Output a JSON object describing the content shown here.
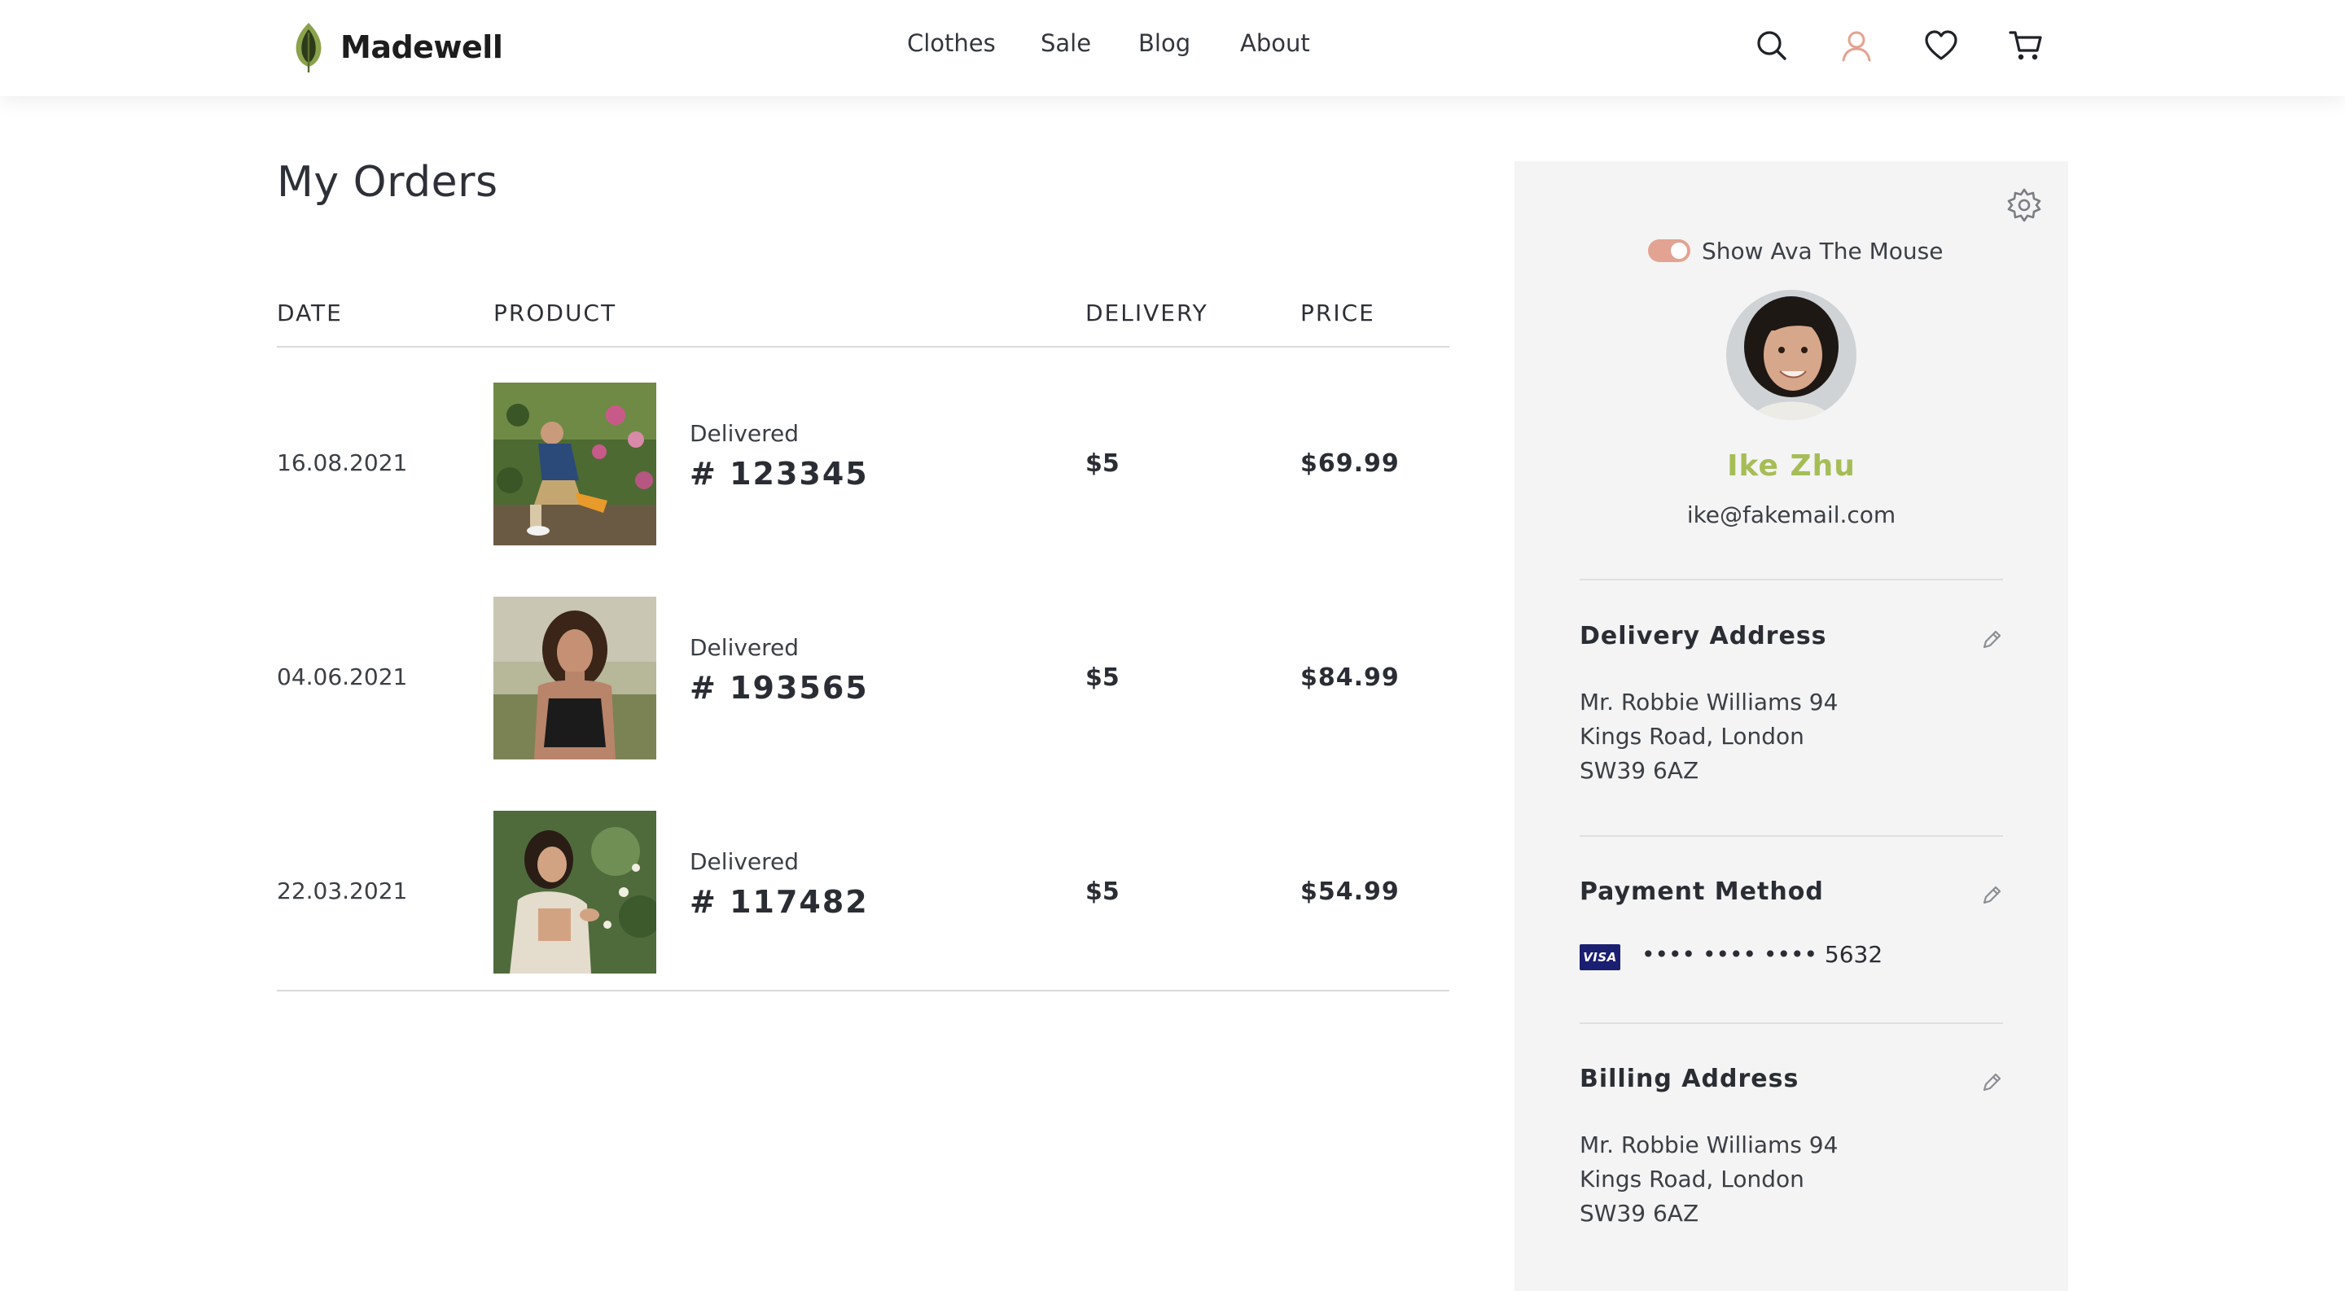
{
  "header": {
    "brand": "Madewell",
    "nav": [
      "Clothes",
      "Sale",
      "Blog",
      "About"
    ],
    "icons": [
      "search-icon",
      "user-icon",
      "heart-icon",
      "cart-icon"
    ],
    "accent_user_icon": "#e2a392"
  },
  "orders": {
    "title": "My Orders",
    "columns": {
      "date": "DATE",
      "product": "PRODUCT",
      "delivery": "DELIVERY",
      "price": "PRICE"
    },
    "rows": [
      {
        "date": "16.08.2021",
        "status": "Delivered",
        "order": "# 123345",
        "delivery": "$5",
        "price": "$69.99"
      },
      {
        "date": "04.06.2021",
        "status": "Delivered",
        "order": "# 193565",
        "delivery": "$5",
        "price": "$84.99"
      },
      {
        "date": "22.03.2021",
        "status": "Delivered",
        "order": "# 117482",
        "delivery": "$5",
        "price": "$54.99"
      }
    ]
  },
  "profile": {
    "toggle_label": "Show Ava The Mouse",
    "toggle_on": true,
    "name": "Ike Zhu",
    "email": "ike@fakemail.com",
    "name_color": "#a6bd57",
    "delivery": {
      "title": "Delivery Address",
      "lines": [
        "Mr. Robbie Williams 94",
        "Kings Road, London",
        "SW39 6AZ"
      ]
    },
    "payment": {
      "title": "Payment Method",
      "card_brand": "VISA",
      "card_number": "•••• •••• •••• 5632"
    },
    "billing": {
      "title": "Billing Address",
      "lines": [
        "Mr. Robbie Williams 94",
        "Kings Road, London",
        "SW39 6AZ"
      ]
    }
  }
}
